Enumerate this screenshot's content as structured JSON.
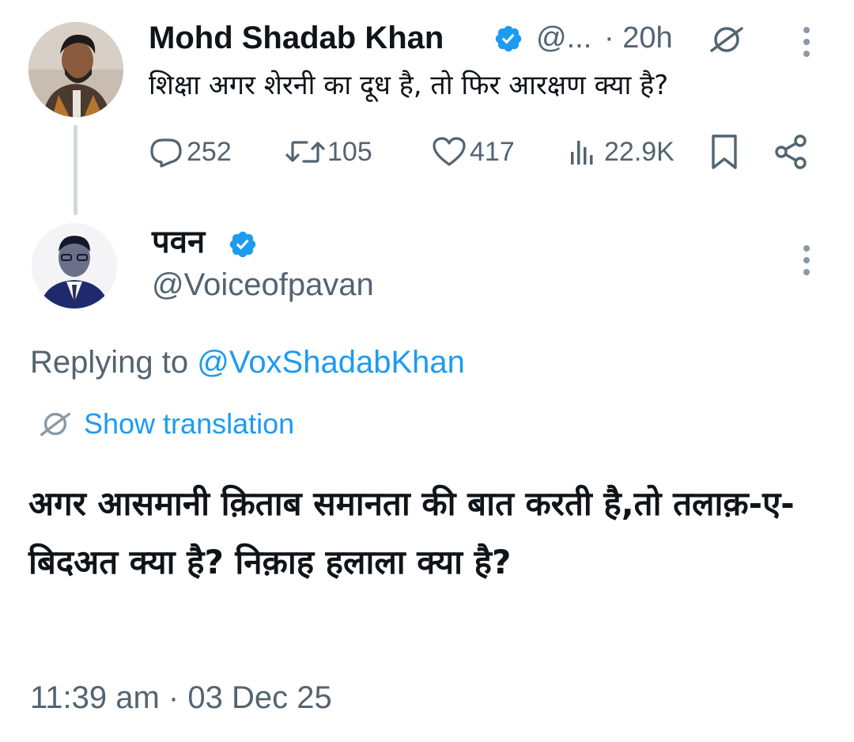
{
  "parent_tweet": {
    "author_name": "Mohd Shadab Khan",
    "handle": "@...",
    "time": "· 20h",
    "text": "शिक्षा अगर शेरनी का दूध है, तो फिर आरक्षण क्या है?",
    "actions": {
      "replies": "252",
      "retweets": "105",
      "likes": "417",
      "views": "22.9K"
    },
    "icons": [
      "verified-badge-icon",
      "translate-globe-icon",
      "more-icon",
      "reply-icon",
      "retweet-icon",
      "like-icon",
      "views-icon",
      "bookmark-icon",
      "share-icon"
    ]
  },
  "reply_tweet": {
    "author_name": "पवन",
    "handle": "@Voiceofpavan",
    "replying_label": "Replying to ",
    "replying_to": "@VoxShadabKhan",
    "show_translation": "Show translation",
    "body": "अगर आसमानी क़िताब समानता की बात करती है,तो तलाक़-ए-बिदअत क्या है? निक़ाह हलाला क्या है?",
    "timestamp": "11:39 am · 03 Dec 25"
  },
  "colors": {
    "accent": "#1d9bf0",
    "secondary_text": "#536471",
    "primary_text": "#0f1419",
    "thread_line": "#cfd9de"
  }
}
